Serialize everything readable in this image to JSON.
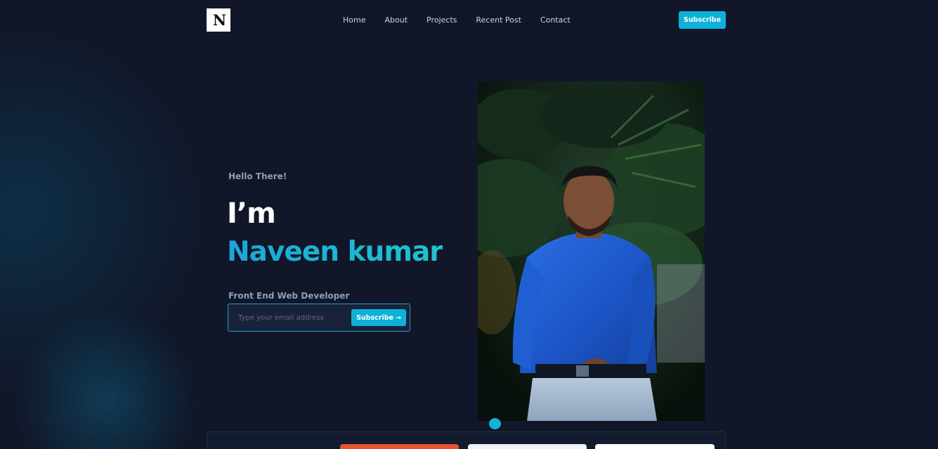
{
  "header": {
    "logo_alt": "N logo",
    "nav": [
      "Home",
      "About",
      "Projects",
      "Recent Post",
      "Contact"
    ],
    "subscribe_label": "Subscribe"
  },
  "hero": {
    "greeting": "Hello There!",
    "intro": "I’m",
    "name": "Naveen kumar",
    "role": "Front End Web Developer",
    "email_placeholder": "Type your email address",
    "subscribe_label": "Subscribe",
    "subscribe_icon": "arrow-right-icon"
  },
  "photo": {
    "subject": "profile-photo"
  },
  "colors": {
    "background": "#111729",
    "accent": "#0fb1d9",
    "name_gradient_start": "#1ba6d8",
    "name_gradient_end": "#1fc3d0",
    "orange": "#e4532f"
  }
}
